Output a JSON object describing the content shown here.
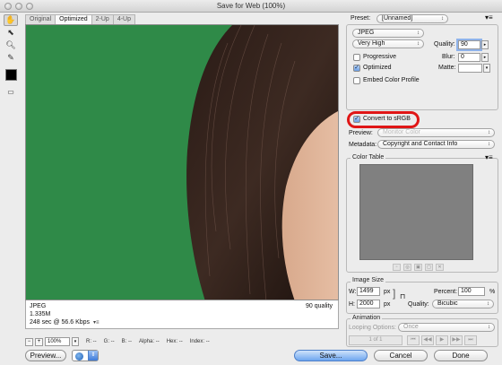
{
  "window": {
    "title": "Save for Web (100%)"
  },
  "tabs": [
    "Original",
    "Optimized",
    "2-Up",
    "4-Up"
  ],
  "tools": [
    "hand-tool-icon",
    "slice-select-icon",
    "zoom-icon",
    "eyedropper-icon"
  ],
  "preview_info": {
    "format": "JPEG",
    "size": "1.335M",
    "time": "248 sec @ 56.6 Kbps",
    "quality": "90 quality"
  },
  "status": {
    "zoom": "100%",
    "r": "R: --",
    "g": "G: --",
    "b": "B: --",
    "alpha": "Alpha: --",
    "hex": "Hex: --",
    "index": "Index: --"
  },
  "buttons": {
    "preview": "Preview...",
    "save": "Save...",
    "cancel": "Cancel",
    "done": "Done"
  },
  "settings": {
    "preset_label": "Preset:",
    "preset_value": "[Unnamed]",
    "format": "JPEG",
    "quality_preset": "Very High",
    "quality_label": "Quality:",
    "quality_value": "90",
    "blur_label": "Blur:",
    "blur_value": "0",
    "matte_label": "Matte:",
    "progressive": {
      "label": "Progressive",
      "checked": false
    },
    "optimized": {
      "label": "Optimized",
      "checked": true
    },
    "embed_profile": {
      "label": "Embed Color Profile",
      "checked": false
    },
    "convert_srgb": {
      "label": "Convert to sRGB",
      "checked": true
    },
    "preview_label": "Preview:",
    "preview_value": "Monitor Color",
    "metadata_label": "Metadata:",
    "metadata_value": "Copyright and Contact Info"
  },
  "color_table": {
    "title": "Color Table"
  },
  "image_size": {
    "title": "Image Size",
    "w_label": "W:",
    "w_value": "1499",
    "h_label": "H:",
    "h_value": "2000",
    "unit": "px",
    "percent_label": "Percent:",
    "percent_value": "100",
    "percent_unit": "%",
    "quality_label": "Quality:",
    "quality_value": "Bicubic"
  },
  "animation": {
    "title": "Animation",
    "looping_label": "Looping Options:",
    "looping_value": "Once",
    "frame": "1 of 1"
  },
  "colors": {
    "highlight": "#e01616",
    "green_screen": "#2f8a48",
    "primary_button": "#6ea6ef"
  }
}
